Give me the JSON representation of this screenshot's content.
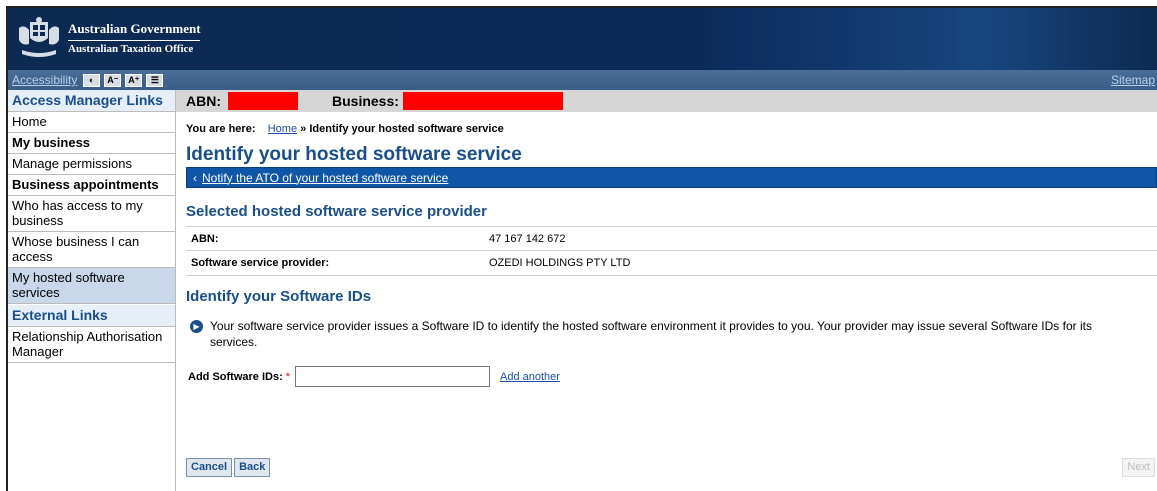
{
  "header": {
    "gov_line1": "Australian Government",
    "gov_line2": "Australian Taxation Office"
  },
  "accessibility": {
    "link": "Accessibility",
    "buttons": [
      "◐",
      "A⁻",
      "A⁺",
      "☰"
    ],
    "sitemap": "Sitemap"
  },
  "sidebar": {
    "heading": "Access Manager Links",
    "items": [
      {
        "label": "Home",
        "bold": false
      },
      {
        "label": "My business",
        "bold": true
      },
      {
        "label": "Manage permissions",
        "bold": false
      },
      {
        "label": "Business appointments",
        "bold": true
      },
      {
        "label": "Who has access to my business",
        "bold": false
      },
      {
        "label": "Whose business I can access",
        "bold": false
      },
      {
        "label": "My hosted software services",
        "bold": false,
        "active": true
      }
    ],
    "external_heading": "External Links",
    "external_items": [
      "Relationship Authorisation Manager"
    ]
  },
  "abnbar": {
    "abn_label": "ABN:",
    "business_label": "Business:"
  },
  "breadcrumb": {
    "prefix": "You are here:",
    "home": "Home",
    "sep": "»",
    "current": "Identify your hosted software service"
  },
  "page": {
    "title": "Identify your hosted software service",
    "back_link": "Notify the ATO of your hosted software service",
    "selected_heading": "Selected hosted software service provider",
    "provider": [
      {
        "label": "ABN:",
        "value": "47 167 142 672"
      },
      {
        "label": "Software service provider:",
        "value": "OZEDI HOLDINGS PTY LTD"
      }
    ],
    "ids_heading": "Identify your Software IDs",
    "info_text": "Your software service provider issues a Software ID to identify the hosted software environment it provides to you. Your provider may issue several Software IDs for its services.",
    "add_label": "Add Software IDs:",
    "required_mark": "*",
    "add_value": "",
    "add_another": "Add another"
  },
  "buttons": {
    "cancel": "Cancel",
    "back": "Back",
    "next": "Next"
  }
}
